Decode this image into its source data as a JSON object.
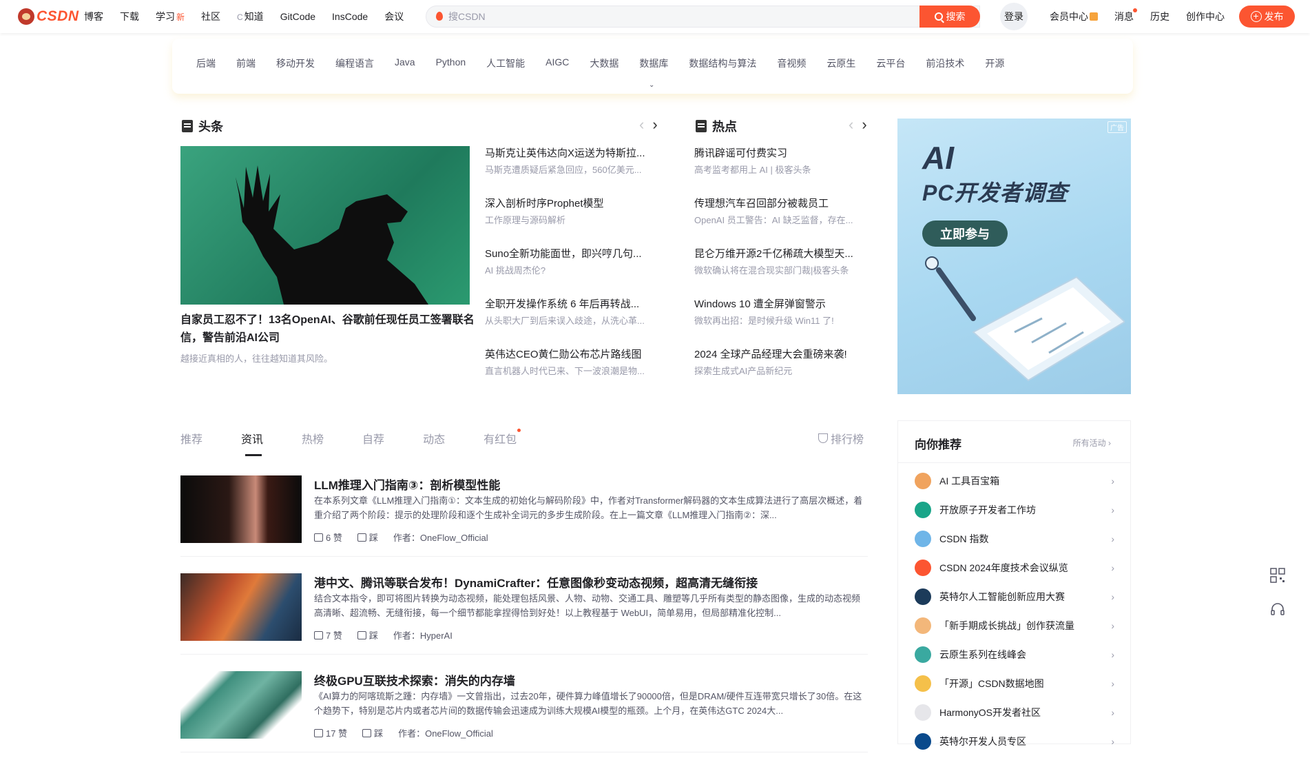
{
  "brand": {
    "logo_text": "CSDN"
  },
  "topnav": [
    "博客",
    "下载",
    "学习",
    "社区",
    "知道",
    "GitCode",
    "InsCode",
    "会议"
  ],
  "topnav_new_tag": "新",
  "search": {
    "placeholder": "搜CSDN",
    "button": "搜索"
  },
  "login": "登录",
  "rightnav": [
    "会员中心",
    "消息",
    "历史",
    "创作中心"
  ],
  "publish": "发布",
  "categories": [
    "后端",
    "前端",
    "移动开发",
    "编程语言",
    "Java",
    "Python",
    "人工智能",
    "AIGC",
    "大数据",
    "数据库",
    "数据结构与算法",
    "音视频",
    "云原生",
    "云平台",
    "前沿技术",
    "开源"
  ],
  "headline": {
    "title": "头条",
    "hero_title": "自家员工忍不了！13名OpenAI、谷歌前任现任员工签署联名信，警告前沿AI公司",
    "hero_desc": "越接近真相的人，往往越知道其风险。",
    "items": [
      {
        "title": "马斯克让英伟达向X运送为特斯拉...",
        "desc": "马斯克遭质疑后紧急回应，560亿美元..."
      },
      {
        "title": "深入剖析时序Prophet模型",
        "desc": "工作原理与源码解析"
      },
      {
        "title": "Suno全新功能面世，即兴哼几句...",
        "desc": "AI 挑战周杰伦?"
      },
      {
        "title": "全职开发操作系统 6 年后再转战...",
        "desc": "从头职大厂到后来误入歧途，从洗心革..."
      },
      {
        "title": "英伟达CEO黄仁勋公布芯片路线图",
        "desc": "直言机器人时代已来、下一波浪潮是物..."
      }
    ]
  },
  "hot": {
    "title": "热点",
    "items": [
      {
        "title": "腾讯辟谣可付费实习",
        "desc": "高考监考都用上 AI | 极客头条"
      },
      {
        "title": "传理想汽车召回部分被裁员工",
        "desc": "OpenAI 员工警告：AI 缺乏监督，存在..."
      },
      {
        "title": "昆仑万维开源2千亿稀疏大模型天...",
        "desc": "微软确认将在混合现实部门裁|极客头条"
      },
      {
        "title": "Windows 10 遭全屏弹窗警示",
        "desc": "微软再出招：是时候升级 Win11 了!"
      },
      {
        "title": "2024 全球产品经理大会重磅来袭!",
        "desc": "探索生成式AI产品新纪元"
      }
    ]
  },
  "ad": {
    "badge": "广告",
    "big": "AI",
    "sub": "PC开发者调查",
    "button": "立即参与"
  },
  "tabs": [
    "推荐",
    "资讯",
    "热榜",
    "自荐",
    "动态",
    "有红包"
  ],
  "active_tab": "资讯",
  "rank": "排行榜",
  "articles": [
    {
      "title": "LLM推理入门指南③：剖析模型性能",
      "desc": "在本系列文章《LLM推理入门指南①：文本生成的初始化与解码阶段》中，作者对Transformer解码器的文本生成算法进行了高层次概述，着重介绍了两个阶段：提示的处理阶段和逐个生成补全词元的多步生成阶段。在上一篇文章《LLM推理入门指南②：深...",
      "likes": "6 赞",
      "dislike": "踩",
      "author": "作者：OneFlow_Official"
    },
    {
      "title": "港中文、腾讯等联合发布！DynamiCrafter：任意图像秒变动态视频，超高清无缝衔接",
      "desc": "结合文本指令，即可将图片转换为动态视频，能处理包括风景、人物、动物、交通工具、雕塑等几乎所有类型的静态图像，生成的动态视频高清晰、超流畅、无缝衔接，每一个细节都能拿捏得恰到好处！以上教程基于 WebUI，简单易用，但局部精准化控制...",
      "likes": "7 赞",
      "dislike": "踩",
      "author": "作者：HyperAI"
    },
    {
      "title": "终极GPU互联技术探索：消失的内存墙",
      "desc": "《AI算力的阿喀琉斯之踵：内存墙》一文曾指出，过去20年，硬件算力峰值增长了90000倍，但是DRAM/硬件互连带宽只增长了30倍。在这个趋势下，特别是芯片内或者芯片间的数据传输会迅速成为训练大规模AI模型的瓶颈。上个月，在英伟达GTC 2024大...",
      "likes": "17 赞",
      "dislike": "踩",
      "author": "作者：OneFlow_Official"
    }
  ],
  "recommend": {
    "title": "向你推荐",
    "all": "所有活动",
    "items": [
      {
        "label": "AI 工具百宝箱",
        "color": "#f0a35e"
      },
      {
        "label": "开放原子开发者工作坊",
        "color": "#1aa589"
      },
      {
        "label": "CSDN 指数",
        "color": "#6fb5e8"
      },
      {
        "label": "CSDN 2024年度技术会议纵览",
        "color": "#fc5531"
      },
      {
        "label": "英特尔人工智能创新应用大赛",
        "color": "#1c3b5a"
      },
      {
        "label": "「新手期成长挑战」创作获流量",
        "color": "#f3b77a"
      },
      {
        "label": "云原生系列在线峰会",
        "color": "#3aa9a0"
      },
      {
        "label": "「开源」CSDN数据地图",
        "color": "#f5c04a"
      },
      {
        "label": "HarmonyOS开发者社区",
        "color": "#e6e6ea"
      },
      {
        "label": "英特尔开发人员专区",
        "color": "#0a4a8c"
      }
    ]
  },
  "colors": {
    "accent": "#fc5531",
    "text": "#222226",
    "muted": "#999aaa"
  }
}
